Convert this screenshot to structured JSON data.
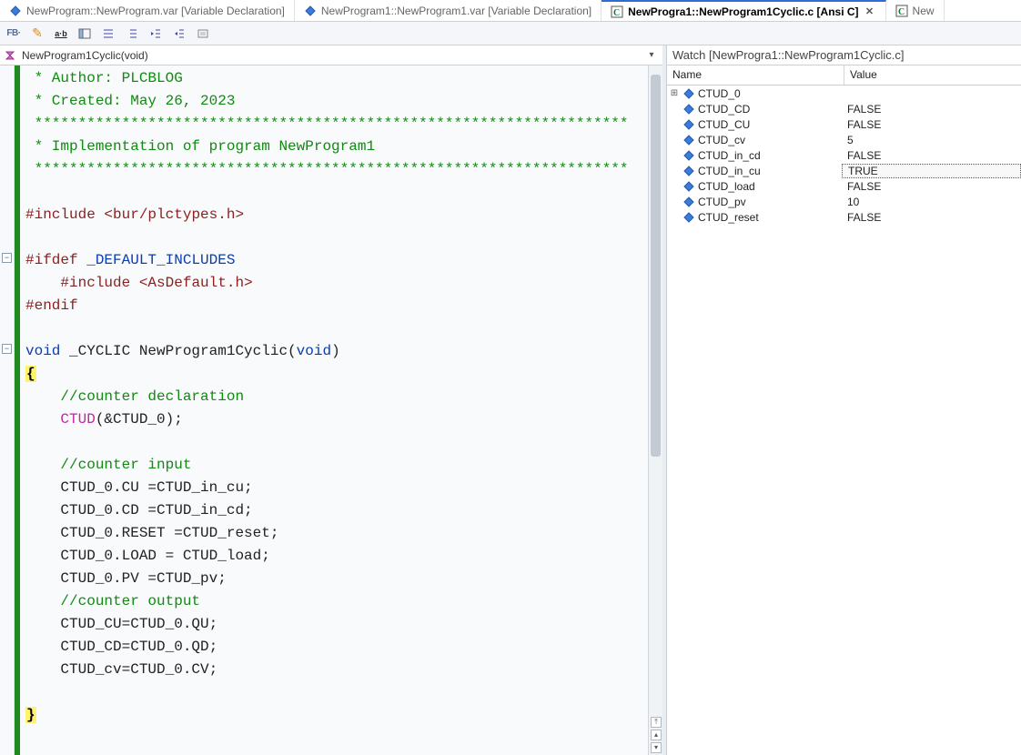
{
  "tabs": [
    {
      "label": "NewProgram::NewProgram.var [Variable Declaration]",
      "icon": "var",
      "active": false,
      "closeable": false
    },
    {
      "label": "NewProgram1::NewProgram1.var [Variable Declaration]",
      "icon": "var",
      "active": false,
      "closeable": false
    },
    {
      "label": "NewProgra1::NewProgram1Cyclic.c [Ansi C]",
      "icon": "c",
      "active": true,
      "closeable": true
    },
    {
      "label": "New",
      "icon": "c",
      "active": false,
      "closeable": false,
      "truncated": true
    }
  ],
  "toolbar": {
    "fb_label": "FB·",
    "ab_label": "a·b"
  },
  "function_bar": {
    "current": "NewProgram1Cyclic(void)"
  },
  "code": {
    "lines": [
      {
        "cls": "commentstar",
        "text": " * Author: PLCBLOG"
      },
      {
        "cls": "commentstar",
        "text": " * Created: May 26, 2023"
      },
      {
        "cls": "commentstar",
        "text": " ********************************************************************"
      },
      {
        "cls": "commentstar",
        "text": " * Implementation of program NewProgram1"
      },
      {
        "cls": "commentstar",
        "text": " ********************************************************************"
      },
      {
        "cls": "blank",
        "text": ""
      },
      {
        "cls": "include",
        "pre": "#include ",
        "arg": "<bur/plctypes.h>"
      },
      {
        "cls": "blank",
        "text": ""
      },
      {
        "cls": "ifdef",
        "pre": "#ifdef ",
        "arg": "_DEFAULT_INCLUDES",
        "fold": true
      },
      {
        "cls": "include_indent",
        "pre": "    #include ",
        "arg": "<AsDefault.h>"
      },
      {
        "cls": "endif",
        "text": "#endif"
      },
      {
        "cls": "blank",
        "text": ""
      },
      {
        "cls": "funcsig",
        "kw1": "void",
        "name": " _CYCLIC NewProgram1Cyclic(",
        "kw2": "void",
        "tail": ")",
        "fold": true
      },
      {
        "cls": "brace_open",
        "text": "{"
      },
      {
        "cls": "comment_inline",
        "indent": "    ",
        "text": "//counter declaration"
      },
      {
        "cls": "call",
        "indent": "    ",
        "fn": "CTUD",
        "args": "(&CTUD_0);"
      },
      {
        "cls": "blank",
        "text": ""
      },
      {
        "cls": "comment_inline",
        "indent": "    ",
        "text": "//counter input"
      },
      {
        "cls": "stmt",
        "indent": "    ",
        "text": "CTUD_0.CU =CTUD_in_cu;"
      },
      {
        "cls": "stmt",
        "indent": "    ",
        "text": "CTUD_0.CD =CTUD_in_cd;"
      },
      {
        "cls": "stmt",
        "indent": "    ",
        "text": "CTUD_0.RESET =CTUD_reset;"
      },
      {
        "cls": "stmt",
        "indent": "    ",
        "text": "CTUD_0.LOAD = CTUD_load;"
      },
      {
        "cls": "stmt",
        "indent": "    ",
        "text": "CTUD_0.PV =CTUD_pv;"
      },
      {
        "cls": "comment_inline",
        "indent": "    ",
        "text": "//counter output"
      },
      {
        "cls": "stmt",
        "indent": "    ",
        "text": "CTUD_CU=CTUD_0.QU;"
      },
      {
        "cls": "stmt",
        "indent": "    ",
        "text": "CTUD_CD=CTUD_0.QD;"
      },
      {
        "cls": "stmt",
        "indent": "    ",
        "text": "CTUD_cv=CTUD_0.CV;"
      },
      {
        "cls": "blank",
        "text": ""
      },
      {
        "cls": "brace_close",
        "text": "}"
      }
    ]
  },
  "watch": {
    "title": "Watch [NewProgra1::NewProgram1Cyclic.c]",
    "columns": {
      "name": "Name",
      "value": "Value"
    },
    "rows": [
      {
        "name": "CTUD_0",
        "value": "",
        "expandable": true
      },
      {
        "name": "CTUD_CD",
        "value": "FALSE"
      },
      {
        "name": "CTUD_CU",
        "value": "FALSE"
      },
      {
        "name": "CTUD_cv",
        "value": "5"
      },
      {
        "name": "CTUD_in_cd",
        "value": "FALSE"
      },
      {
        "name": "CTUD_in_cu",
        "value": "TRUE",
        "selected": true
      },
      {
        "name": "CTUD_load",
        "value": "FALSE"
      },
      {
        "name": "CTUD_pv",
        "value": "10"
      },
      {
        "name": "CTUD_reset",
        "value": "FALSE"
      }
    ]
  }
}
